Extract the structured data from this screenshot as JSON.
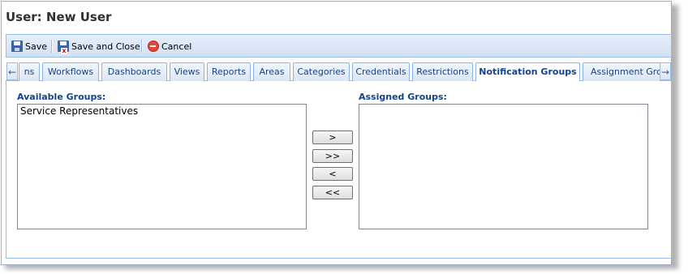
{
  "window": {
    "title": "User: New User"
  },
  "toolbar": {
    "save_label": "Save",
    "save_close_label": "Save and Close",
    "cancel_label": "Cancel"
  },
  "tabs": {
    "items": [
      {
        "label": "ns"
      },
      {
        "label": "Workflows"
      },
      {
        "label": "Dashboards"
      },
      {
        "label": "Views"
      },
      {
        "label": "Reports"
      },
      {
        "label": "Areas"
      },
      {
        "label": "Categories"
      },
      {
        "label": "Credentials"
      },
      {
        "label": "Restrictions"
      },
      {
        "label": "Notification Groups",
        "active": true
      },
      {
        "label": "Assignment Grou"
      }
    ],
    "scroll_left_icon": "arrow-left-icon",
    "scroll_right_icon": "arrow-right-icon"
  },
  "available": {
    "label": "Available Groups:",
    "options": [
      "Service Representatives"
    ]
  },
  "assigned": {
    "label": "Assigned Groups:",
    "options": []
  },
  "move_buttons": {
    "add": ">",
    "add_all": ">>",
    "remove": "<",
    "remove_all": "<<"
  },
  "colors": {
    "accent": "#15428b",
    "border": "#99bbe8",
    "cancel": "#e0483e"
  }
}
